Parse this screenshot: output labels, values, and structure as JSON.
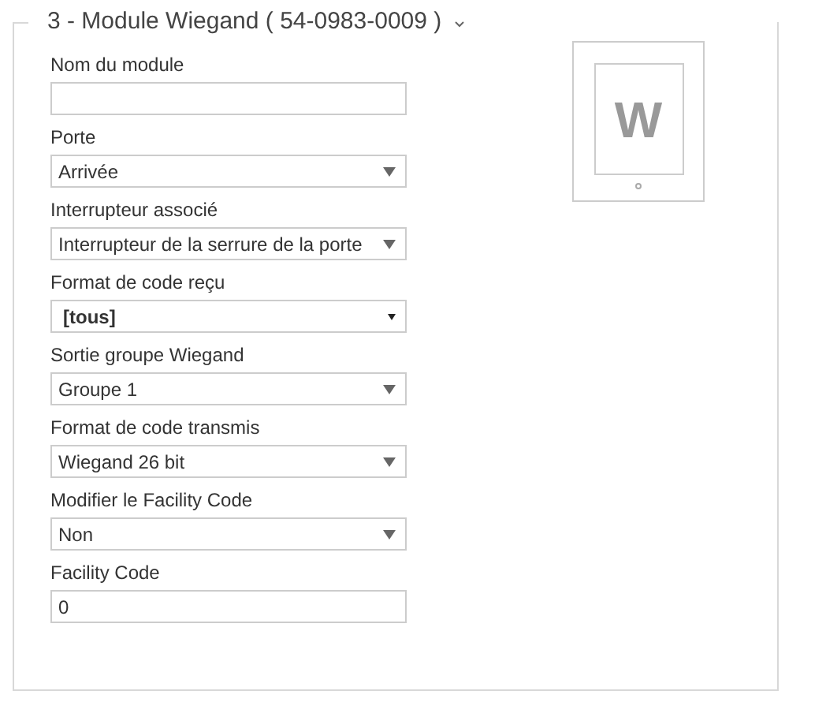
{
  "section": {
    "title": "3 - Module Wiegand ( 54-0983-0009 )",
    "expanded": true
  },
  "fields": [
    {
      "label": "Nom du module",
      "kind": "input"
    },
    {
      "label": "Porte",
      "kind": "select",
      "value": "Arrivée"
    },
    {
      "label": "Interrupteur associé",
      "kind": "select",
      "value": "Interrupteur de la serrure de la porte"
    },
    {
      "label": "Format de code reçu",
      "kind": "native_select",
      "value": "[tous]"
    },
    {
      "label": "Sortie groupe Wiegand",
      "kind": "select",
      "value": "Groupe 1"
    },
    {
      "label": "Format de code transmis",
      "kind": "select",
      "value": "Wiegand 26 bit"
    },
    {
      "label": "Modifier le Facility Code",
      "kind": "select",
      "value": "Non"
    },
    {
      "label": "Facility Code",
      "kind": "input",
      "value": "0"
    }
  ],
  "module_image": {
    "letter": "W"
  }
}
